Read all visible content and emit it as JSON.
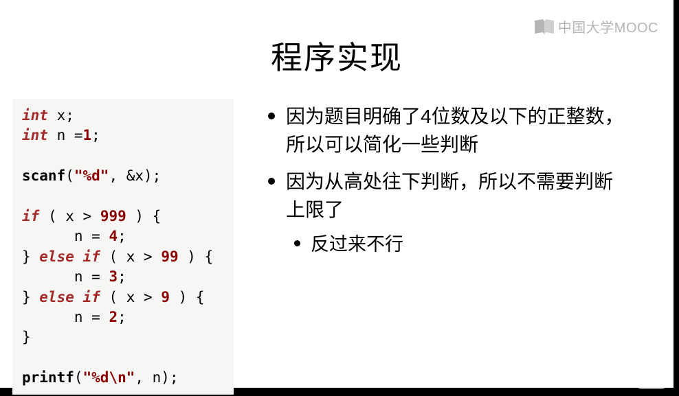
{
  "watermark": {
    "text": "中国大学MOOC"
  },
  "title": "程序实现",
  "code": {
    "line1_kw": "int",
    "line1_rest": " x;",
    "line2_kw": "int",
    "line2_rest": " n =",
    "line2_num": "1",
    "line2_end": ";",
    "line4_fn": "scanf",
    "line4_open": "(",
    "line4_str": "\"%d\"",
    "line4_rest": ", &x);",
    "line6_kw": "if",
    "line6_rest": " ( x > ",
    "line6_num": "999",
    "line6_end": " ) {",
    "line7_pre": "      n = ",
    "line7_num": "4",
    "line7_end": ";",
    "line8_pre": "} ",
    "line8_kw": "else if",
    "line8_rest": " ( x > ",
    "line8_num": "99",
    "line8_end": " ) {",
    "line9_pre": "      n = ",
    "line9_num": "3",
    "line9_end": ";",
    "line10_pre": "} ",
    "line10_kw": "else if",
    "line10_rest": " ( x > ",
    "line10_num": "9",
    "line10_end": " ) {",
    "line11_pre": "      n = ",
    "line11_num": "2",
    "line11_end": ";",
    "line12": "}",
    "line14_fn": "printf",
    "line14_open": "(",
    "line14_str": "\"%d\\n\"",
    "line14_rest": ", n);"
  },
  "bullets": {
    "items": [
      "因为题目明确了4位数及以下的正整数，所以可以简化一些判断",
      "因为从高处往下判断，所以不需要判断上限了"
    ],
    "sub": "反过来不行"
  }
}
